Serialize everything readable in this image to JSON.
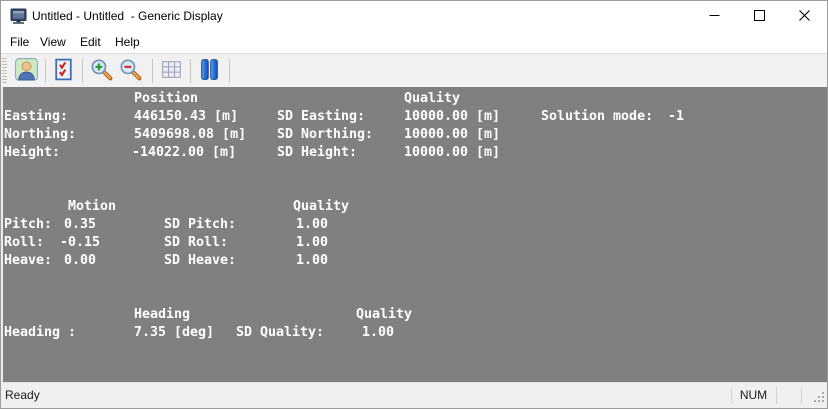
{
  "window": {
    "title": "Untitled - Untitled  - Generic Display",
    "app_icon": "display-monitor",
    "controls": [
      "minimize",
      "maximize",
      "close"
    ]
  },
  "menu": {
    "items": [
      "File",
      "View",
      "Edit",
      "Help"
    ]
  },
  "toolbar": {
    "buttons": [
      "user",
      "checklist",
      "zoom-in",
      "zoom-out",
      "grid",
      "pause"
    ]
  },
  "telemetry": {
    "position": {
      "section_title": "Position",
      "quality_title": "Quality",
      "rows": [
        {
          "label": "Easting:",
          "value": "446150.43 [m]",
          "sd_label": "SD Easting:",
          "sd_value": "10000.00 [m]"
        },
        {
          "label": "Northing:",
          "value": "5409698.08 [m]",
          "sd_label": "SD Northing:",
          "sd_value": "10000.00 [m]"
        },
        {
          "label": "Height:",
          "value": "-14022.00 [m]",
          "sd_label": "SD Height:",
          "sd_value": "10000.00 [m]"
        }
      ],
      "solution_mode_label": "Solution mode:",
      "solution_mode_value": "-1"
    },
    "motion": {
      "section_title": "Motion",
      "quality_title": "Quality",
      "rows": [
        {
          "label": "Pitch:",
          "value": "0.35",
          "sd_label": "SD Pitch:",
          "sd_value": "1.00"
        },
        {
          "label": "Roll:",
          "value": "-0.15",
          "sd_label": "SD Roll:",
          "sd_value": "1.00"
        },
        {
          "label": "Heave:",
          "value": "0.00",
          "sd_label": "SD Heave:",
          "sd_value": "1.00"
        }
      ]
    },
    "heading": {
      "section_title": "Heading",
      "quality_title": "Quality",
      "row": {
        "label": "Heading :",
        "value": "7.35 [deg]",
        "sd_label": "SD Quality:",
        "sd_value": "1.00"
      }
    }
  },
  "statusbar": {
    "ready": "Ready",
    "num": "NUM"
  },
  "colors": {
    "client_background": "#808080",
    "client_text": "#ffffff",
    "toolbar_background": "#f1f1f1",
    "statusbar_background": "#f0f0f0"
  }
}
